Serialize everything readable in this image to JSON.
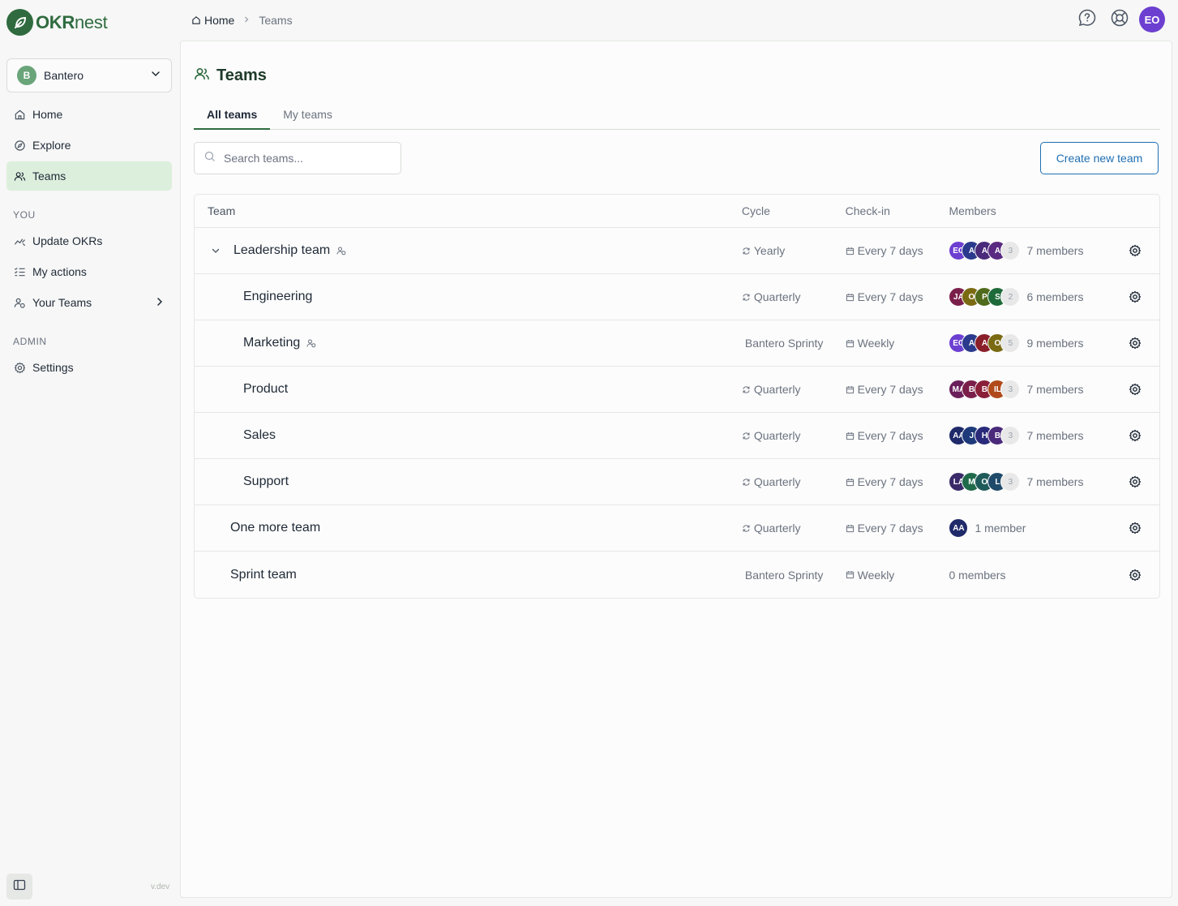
{
  "brand": {
    "name_bold": "OKR",
    "name_light": "nest"
  },
  "org": {
    "initial": "B",
    "name": "Bantero"
  },
  "sidebar": {
    "items": [
      {
        "label": "Home",
        "icon": "home-icon"
      },
      {
        "label": "Explore",
        "icon": "compass-icon"
      },
      {
        "label": "Teams",
        "icon": "users-icon",
        "active": true
      }
    ],
    "you_label": "YOU",
    "you_items": [
      {
        "label": "Update OKRs",
        "icon": "activity-icon"
      },
      {
        "label": "My actions",
        "icon": "list-checks-icon"
      },
      {
        "label": "Your Teams",
        "icon": "user-group-icon"
      }
    ],
    "admin_label": "ADMIN",
    "admin_items": [
      {
        "label": "Settings",
        "icon": "gear-icon"
      }
    ],
    "version": "v.dev"
  },
  "breadcrumb": {
    "home": "Home",
    "current": "Teams"
  },
  "user": {
    "initials": "EO",
    "color": "#6d3fd1"
  },
  "page": {
    "title": "Teams"
  },
  "tabs": [
    {
      "label": "All teams",
      "active": true
    },
    {
      "label": "My teams"
    }
  ],
  "search": {
    "placeholder": "Search teams..."
  },
  "create_button": "Create new team",
  "table": {
    "headers": {
      "team": "Team",
      "cycle": "Cycle",
      "checkin": "Check-in",
      "members": "Members"
    },
    "rows": [
      {
        "name": "Leadership team",
        "level": 0,
        "expanded": true,
        "has_badge": true,
        "cycle": "Yearly",
        "cycle_icon": true,
        "checkin": "Every 7 days",
        "avatars": [
          {
            "i": "EO",
            "c": "#6d3fd1"
          },
          {
            "i": "A",
            "c": "#2b3a8c"
          },
          {
            "i": "A",
            "c": "#4a2a7a"
          },
          {
            "i": "A",
            "c": "#5a2a82"
          }
        ],
        "more": "3",
        "members": "7 members"
      },
      {
        "name": "Engineering",
        "level": 1,
        "has_badge": false,
        "cycle": "Quarterly",
        "cycle_icon": true,
        "checkin": "Every 7 days",
        "avatars": [
          {
            "i": "JA",
            "c": "#7a1f4a"
          },
          {
            "i": "O",
            "c": "#7a6a12"
          },
          {
            "i": "P",
            "c": "#4f6a1a"
          },
          {
            "i": "S",
            "c": "#1f6a3a"
          }
        ],
        "more": "2",
        "members": "6 members"
      },
      {
        "name": "Marketing",
        "level": 1,
        "has_badge": true,
        "cycle": "Bantero Sprinty",
        "cycle_icon": false,
        "checkin": "Weekly",
        "avatars": [
          {
            "i": "EO",
            "c": "#6d3fd1"
          },
          {
            "i": "A",
            "c": "#2b3a8c"
          },
          {
            "i": "A",
            "c": "#8a1f2a"
          },
          {
            "i": "O",
            "c": "#7a6a12"
          }
        ],
        "more": "5",
        "members": "9 members"
      },
      {
        "name": "Product",
        "level": 1,
        "has_badge": false,
        "cycle": "Quarterly",
        "cycle_icon": true,
        "checkin": "Every 7 days",
        "avatars": [
          {
            "i": "MA",
            "c": "#6a1f5a"
          },
          {
            "i": "B",
            "c": "#7a1f4a"
          },
          {
            "i": "B",
            "c": "#8a1f3a"
          },
          {
            "i": "IL",
            "c": "#b04a1a"
          }
        ],
        "more": "3",
        "members": "7 members"
      },
      {
        "name": "Sales",
        "level": 1,
        "has_badge": false,
        "cycle": "Quarterly",
        "cycle_icon": true,
        "checkin": "Every 7 days",
        "avatars": [
          {
            "i": "AA",
            "c": "#1f2a6a"
          },
          {
            "i": "J",
            "c": "#1f3a7a"
          },
          {
            "i": "H",
            "c": "#2a2a7a"
          },
          {
            "i": "B",
            "c": "#4a2a7a"
          }
        ],
        "more": "3",
        "members": "7 members"
      },
      {
        "name": "Support",
        "level": 1,
        "has_badge": false,
        "cycle": "Quarterly",
        "cycle_icon": true,
        "checkin": "Every 7 days",
        "avatars": [
          {
            "i": "LA",
            "c": "#3a2a6a"
          },
          {
            "i": "M",
            "c": "#1f6a4a"
          },
          {
            "i": "O",
            "c": "#1f5a5a"
          },
          {
            "i": "L",
            "c": "#1f4a6a"
          }
        ],
        "more": "3",
        "members": "7 members"
      },
      {
        "name": "One more team",
        "level": 0,
        "has_badge": false,
        "cycle": "Quarterly",
        "cycle_icon": true,
        "checkin": "Every 7 days",
        "avatars": [
          {
            "i": "AA",
            "c": "#1f2a6a"
          }
        ],
        "more": "",
        "members": "1 member"
      },
      {
        "name": "Sprint team",
        "level": 0,
        "has_badge": false,
        "cycle": "Bantero Sprinty",
        "cycle_icon": false,
        "checkin": "Weekly",
        "avatars": [],
        "more": "",
        "members": "0 members"
      }
    ]
  }
}
